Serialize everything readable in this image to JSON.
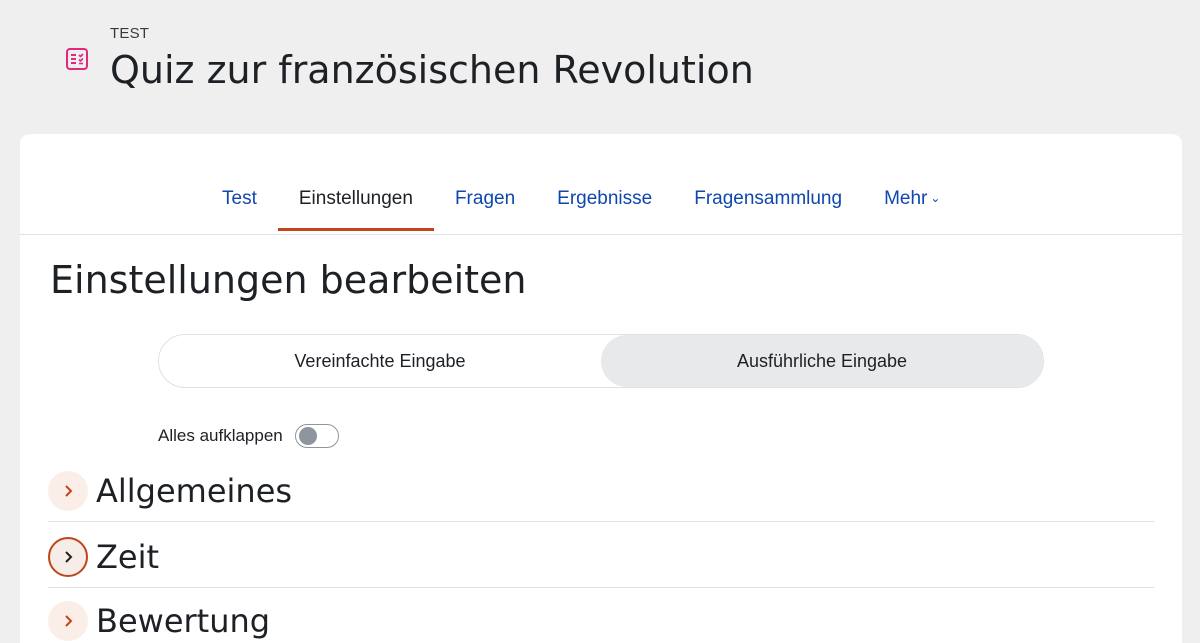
{
  "header": {
    "module_type": "TEST",
    "title": "Quiz zur französischen Revolution"
  },
  "secondary_nav": {
    "items": [
      {
        "label": "Test"
      },
      {
        "label": "Einstellungen"
      },
      {
        "label": "Fragen"
      },
      {
        "label": "Ergebnisse"
      },
      {
        "label": "Fragensammlung"
      },
      {
        "label": "Mehr"
      }
    ],
    "active": "Einstellungen"
  },
  "main": {
    "heading": "Einstellungen bearbeiten",
    "mode_switch": {
      "options": [
        "Vereinfachte Eingabe",
        "Ausführliche Eingabe"
      ],
      "selected": "Ausführliche Eingabe"
    },
    "expand_all": {
      "label": "Alles aufklappen",
      "checked": false
    },
    "sections": [
      {
        "title": "Allgemeines"
      },
      {
        "title": "Zeit"
      },
      {
        "title": "Bewertung"
      }
    ]
  },
  "colors": {
    "accent": "#c0451a",
    "link": "#0f47ad",
    "icon_pink": "#e0297c"
  }
}
